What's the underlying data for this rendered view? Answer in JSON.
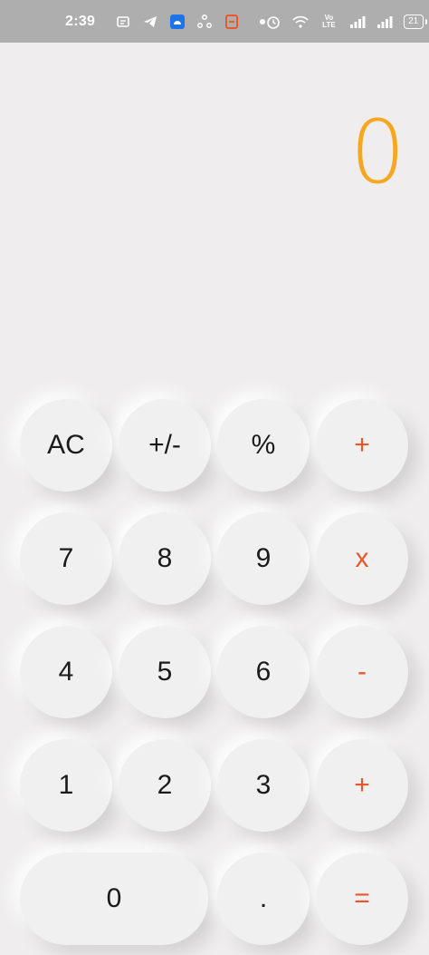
{
  "status_bar": {
    "time": "2:39",
    "battery": "21",
    "volte": "Vo LTE"
  },
  "display": {
    "value": "0",
    "color": "#f5a81f"
  },
  "colors": {
    "operator": "#e8562a",
    "digit": "#1a1a1a",
    "background": "#efeded"
  },
  "keys": {
    "ac": "AC",
    "sign": "+/-",
    "percent": "%",
    "op_top": "+",
    "seven": "7",
    "eight": "8",
    "nine": "9",
    "multiply": "x",
    "four": "4",
    "five": "5",
    "six": "6",
    "minus": "-",
    "one": "1",
    "two": "2",
    "three": "3",
    "plus": "+",
    "zero": "0",
    "dot": ".",
    "equals": "="
  }
}
